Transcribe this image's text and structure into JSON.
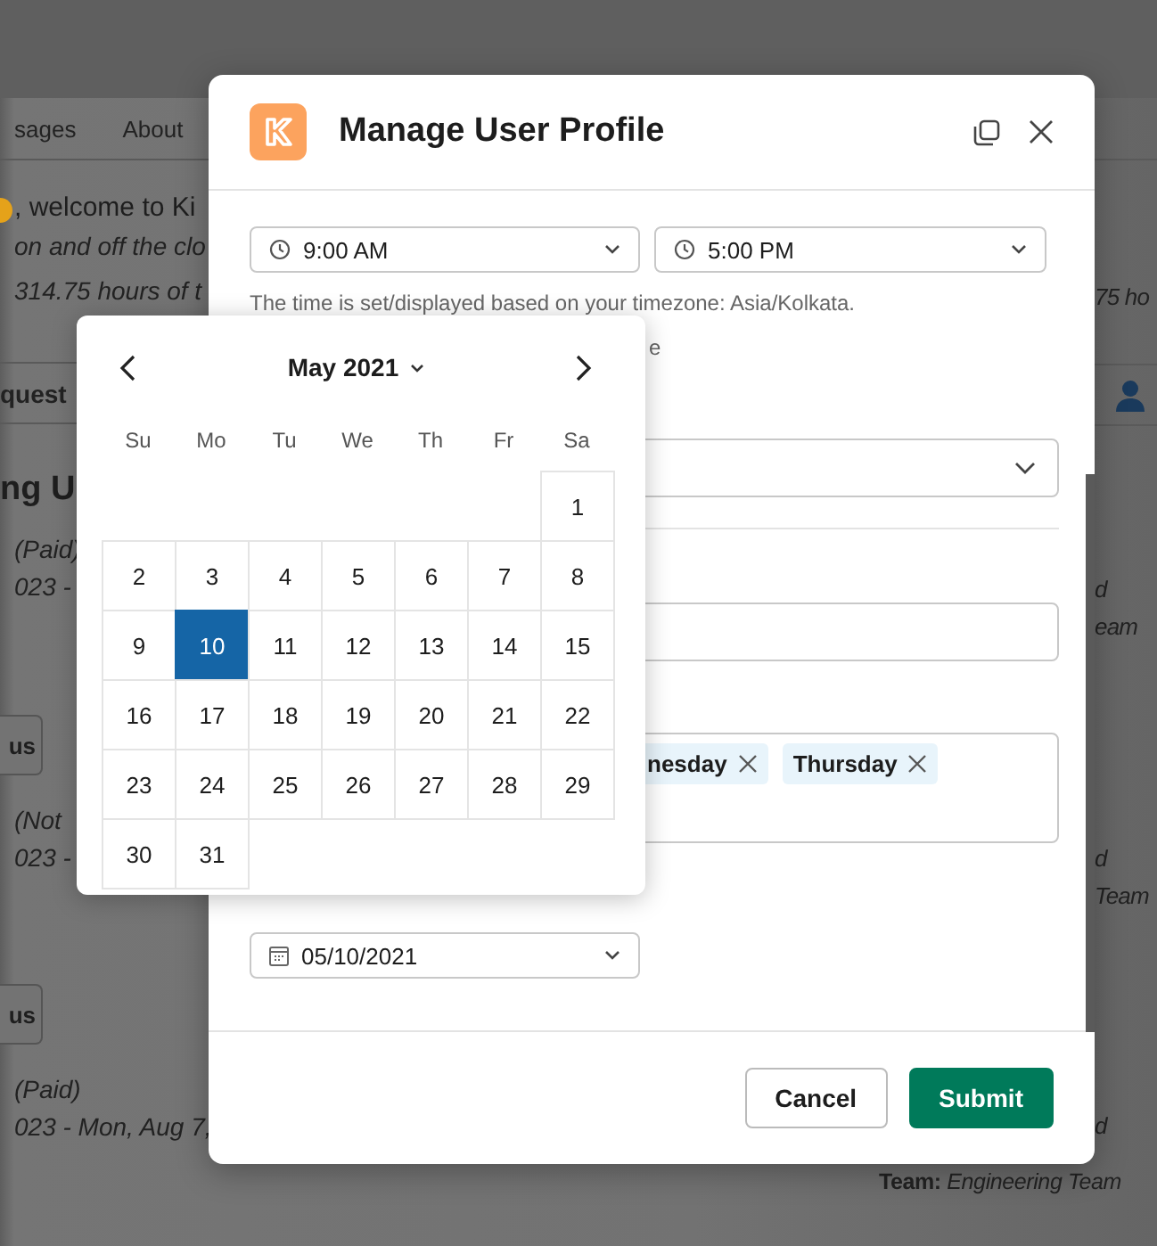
{
  "background": {
    "nav_tabs": [
      "sages",
      "About"
    ],
    "left": [
      {
        "kind": "greeting",
        "text": ", welcome to Ki"
      },
      {
        "kind": "italic",
        "text": "on and off the clo"
      },
      {
        "kind": "italic",
        "text": "314.75 hours of t"
      },
      {
        "kind": "band",
        "text": "quest"
      },
      {
        "kind": "title",
        "text": "ng U"
      },
      {
        "kind": "italic",
        "text": "(Paid)"
      },
      {
        "kind": "italic",
        "text": "023 -"
      },
      {
        "kind": "button",
        "text": "us"
      },
      {
        "kind": "italic",
        "text": "(Not"
      },
      {
        "kind": "italic",
        "text": "023 -"
      },
      {
        "kind": "button",
        "text": "us"
      },
      {
        "kind": "italic",
        "text": "(Paid)"
      },
      {
        "kind": "italic",
        "text": "023 - Mon, Aug 7,"
      }
    ],
    "right": [
      {
        "kind": "italic",
        "text": "75 ho"
      },
      {
        "kind": "band"
      },
      {
        "kind": "italic",
        "text": "d"
      },
      {
        "kind": "italic",
        "text": "eam"
      },
      {
        "kind": "italic",
        "text": "d"
      },
      {
        "kind": "italic",
        "text": "Team"
      },
      {
        "kind": "italic",
        "text": "d"
      },
      {
        "kind": "team",
        "label": "Team:",
        "text": "Engineering Team"
      }
    ]
  },
  "modal": {
    "title": "Manage User Profile",
    "start_time": "9:00 AM",
    "end_time": "5:00 PM",
    "timezone_note": "The time is set/displayed based on your timezone: Asia/Kolkata.",
    "note_fragment": "e",
    "tags": [
      "nesday",
      "Thursday"
    ],
    "date": "05/10/2021",
    "buttons": [
      {
        "kind": "secondary",
        "label": "Cancel"
      },
      {
        "kind": "primary",
        "label": "Submit"
      }
    ]
  },
  "calendar": {
    "month": "May 2021",
    "weekdays": [
      "Su",
      "Mo",
      "Tu",
      "We",
      "Th",
      "Fr",
      "Sa"
    ],
    "weeks": [
      [
        {
          "label": "1",
          "selected": false
        }
      ],
      [
        {
          "label": "2",
          "selected": false
        },
        {
          "label": "3",
          "selected": false
        },
        {
          "label": "4",
          "selected": false
        },
        {
          "label": "5",
          "selected": false
        },
        {
          "label": "6",
          "selected": false
        },
        {
          "label": "7",
          "selected": false
        },
        {
          "label": "8",
          "selected": false
        }
      ],
      [
        {
          "label": "9",
          "selected": false
        },
        {
          "label": "10",
          "selected": true
        },
        {
          "label": "11",
          "selected": false
        },
        {
          "label": "12",
          "selected": false
        },
        {
          "label": "13",
          "selected": false
        },
        {
          "label": "14",
          "selected": false
        },
        {
          "label": "15",
          "selected": false
        }
      ],
      [
        {
          "label": "16",
          "selected": false
        },
        {
          "label": "17",
          "selected": false
        },
        {
          "label": "18",
          "selected": false
        },
        {
          "label": "19",
          "selected": false
        },
        {
          "label": "20",
          "selected": false
        },
        {
          "label": "21",
          "selected": false
        },
        {
          "label": "22",
          "selected": false
        }
      ],
      [
        {
          "label": "23",
          "selected": false
        },
        {
          "label": "24",
          "selected": false
        },
        {
          "label": "25",
          "selected": false
        },
        {
          "label": "26",
          "selected": false
        },
        {
          "label": "27",
          "selected": false
        },
        {
          "label": "28",
          "selected": false
        },
        {
          "label": "29",
          "selected": false
        }
      ],
      [
        {
          "label": "30",
          "selected": false
        },
        {
          "label": "31",
          "selected": false
        }
      ]
    ]
  }
}
